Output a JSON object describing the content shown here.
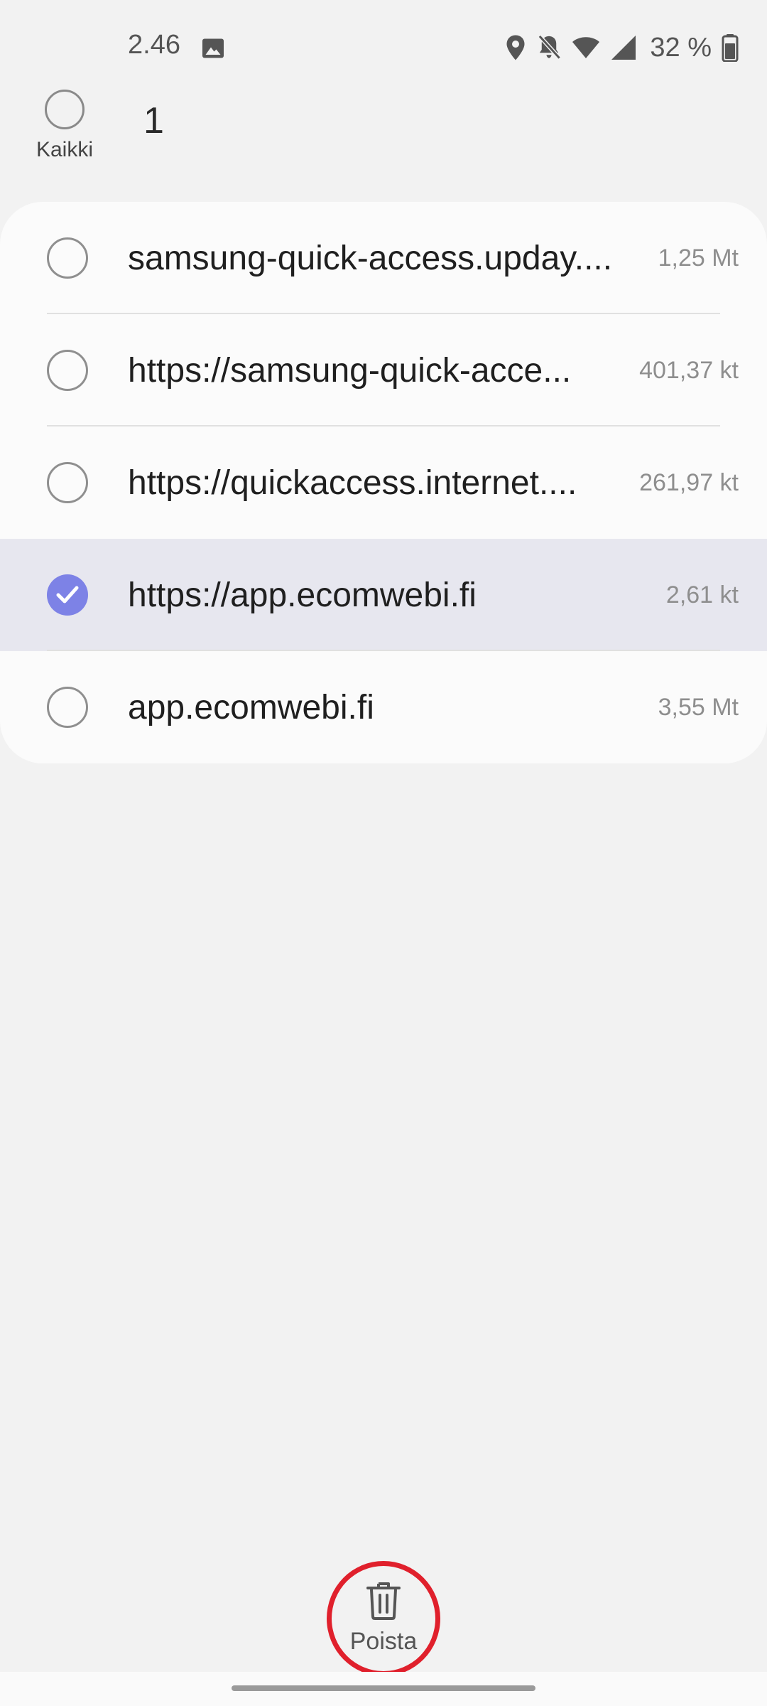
{
  "status_bar": {
    "time": "2.46",
    "battery_text": "32 %",
    "icons": [
      "gallery-icon",
      "location-icon",
      "bell-off-icon",
      "wifi-icon",
      "signal-icon",
      "battery-icon"
    ]
  },
  "header": {
    "select_all_label": "Kaikki",
    "selected_count": "1"
  },
  "items": [
    {
      "name": "samsung-quick-access.upday....",
      "size": "1,25 Mt",
      "selected": false
    },
    {
      "name": "https://samsung-quick-acce...",
      "size": "401,37 kt",
      "selected": false
    },
    {
      "name": "https://quickaccess.internet....",
      "size": "261,97 kt",
      "selected": false
    },
    {
      "name": "https://app.ecomwebi.fi",
      "size": "2,61 kt",
      "selected": true
    },
    {
      "name": "app.ecomwebi.fi",
      "size": "3,55 Mt",
      "selected": false
    }
  ],
  "bottom_action": {
    "delete_label": "Poista",
    "icon": "trash-icon"
  },
  "colors": {
    "accent": "#7d82e6",
    "selected_row": "#e7e7ef",
    "highlight_ring": "#e0202c",
    "background": "#f2f2f2"
  }
}
